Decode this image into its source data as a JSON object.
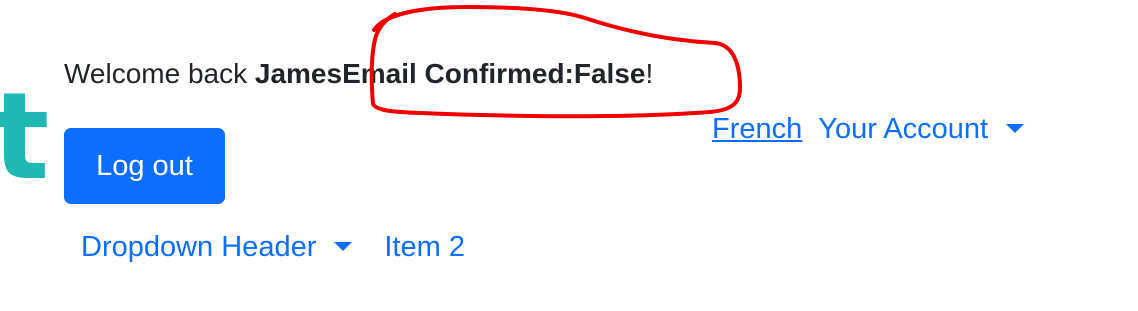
{
  "header": {
    "logo_fragment": "t",
    "welcome_prefix": "Welcome back ",
    "user_name": "James",
    "email_status": "Email Confirmed:False",
    "welcome_suffix": "!"
  },
  "account_nav": {
    "language_link": "French",
    "account_menu_label": "Your Account"
  },
  "actions": {
    "logout_label": "Log out"
  },
  "menu": {
    "dropdown_header_label": "Dropdown Header",
    "item_2_label": "Item 2"
  },
  "colors": {
    "primary": "#0d6efd",
    "logo_teal": "#20b8b3",
    "annotation_red": "#ee0000",
    "text": "#212529"
  }
}
